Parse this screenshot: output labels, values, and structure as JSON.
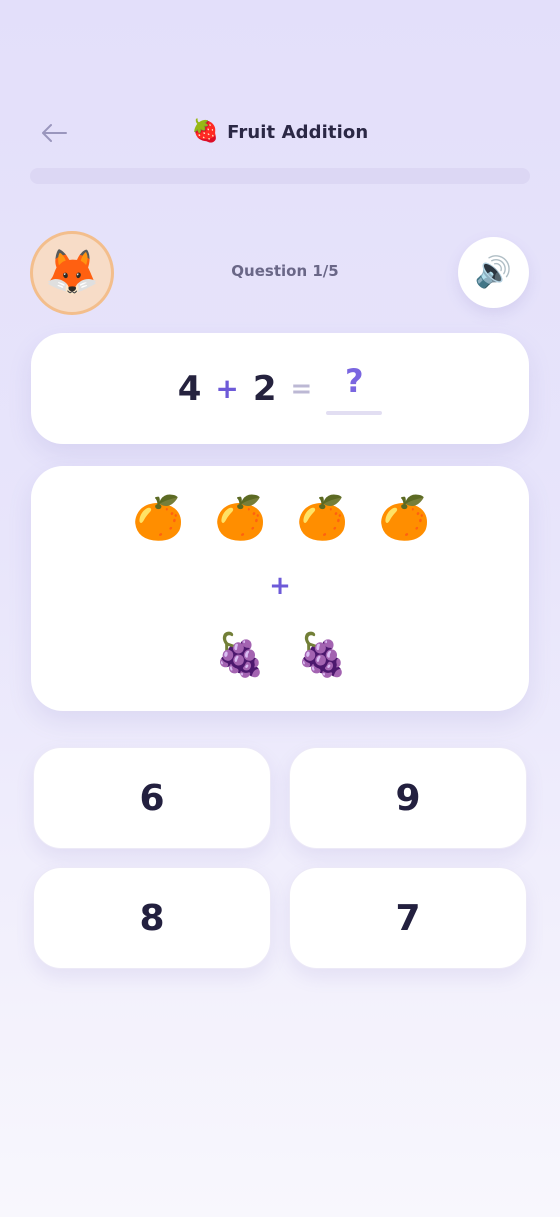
{
  "header": {
    "title": "Fruit Addition",
    "title_icon": "🍓",
    "title_icon_name": "strawberry-icon",
    "back_icon": "arrow-left-icon"
  },
  "progress": {
    "fraction": 0.0
  },
  "avatar": {
    "emoji": "🦊",
    "icon_name": "fox-icon"
  },
  "question": {
    "label": "Question 1/5"
  },
  "sound": {
    "emoji": "🔊",
    "icon_name": "speaker-icon"
  },
  "equation": {
    "a": "4",
    "op": "+",
    "b": "2",
    "eq": "=",
    "answer_placeholder": "?"
  },
  "fruits": {
    "group_a": {
      "emoji": "🍊",
      "count": 4,
      "icon_name": "orange-icon"
    },
    "plus": "+",
    "group_b": {
      "emoji": "🍇",
      "count": 2,
      "icon_name": "grapes-icon"
    }
  },
  "answers": [
    {
      "label": "6"
    },
    {
      "label": "9"
    },
    {
      "label": "8"
    },
    {
      "label": "7"
    }
  ],
  "colors": {
    "accent": "#6d5ad8",
    "background": "#e5e1fa",
    "text": "#23203f"
  }
}
